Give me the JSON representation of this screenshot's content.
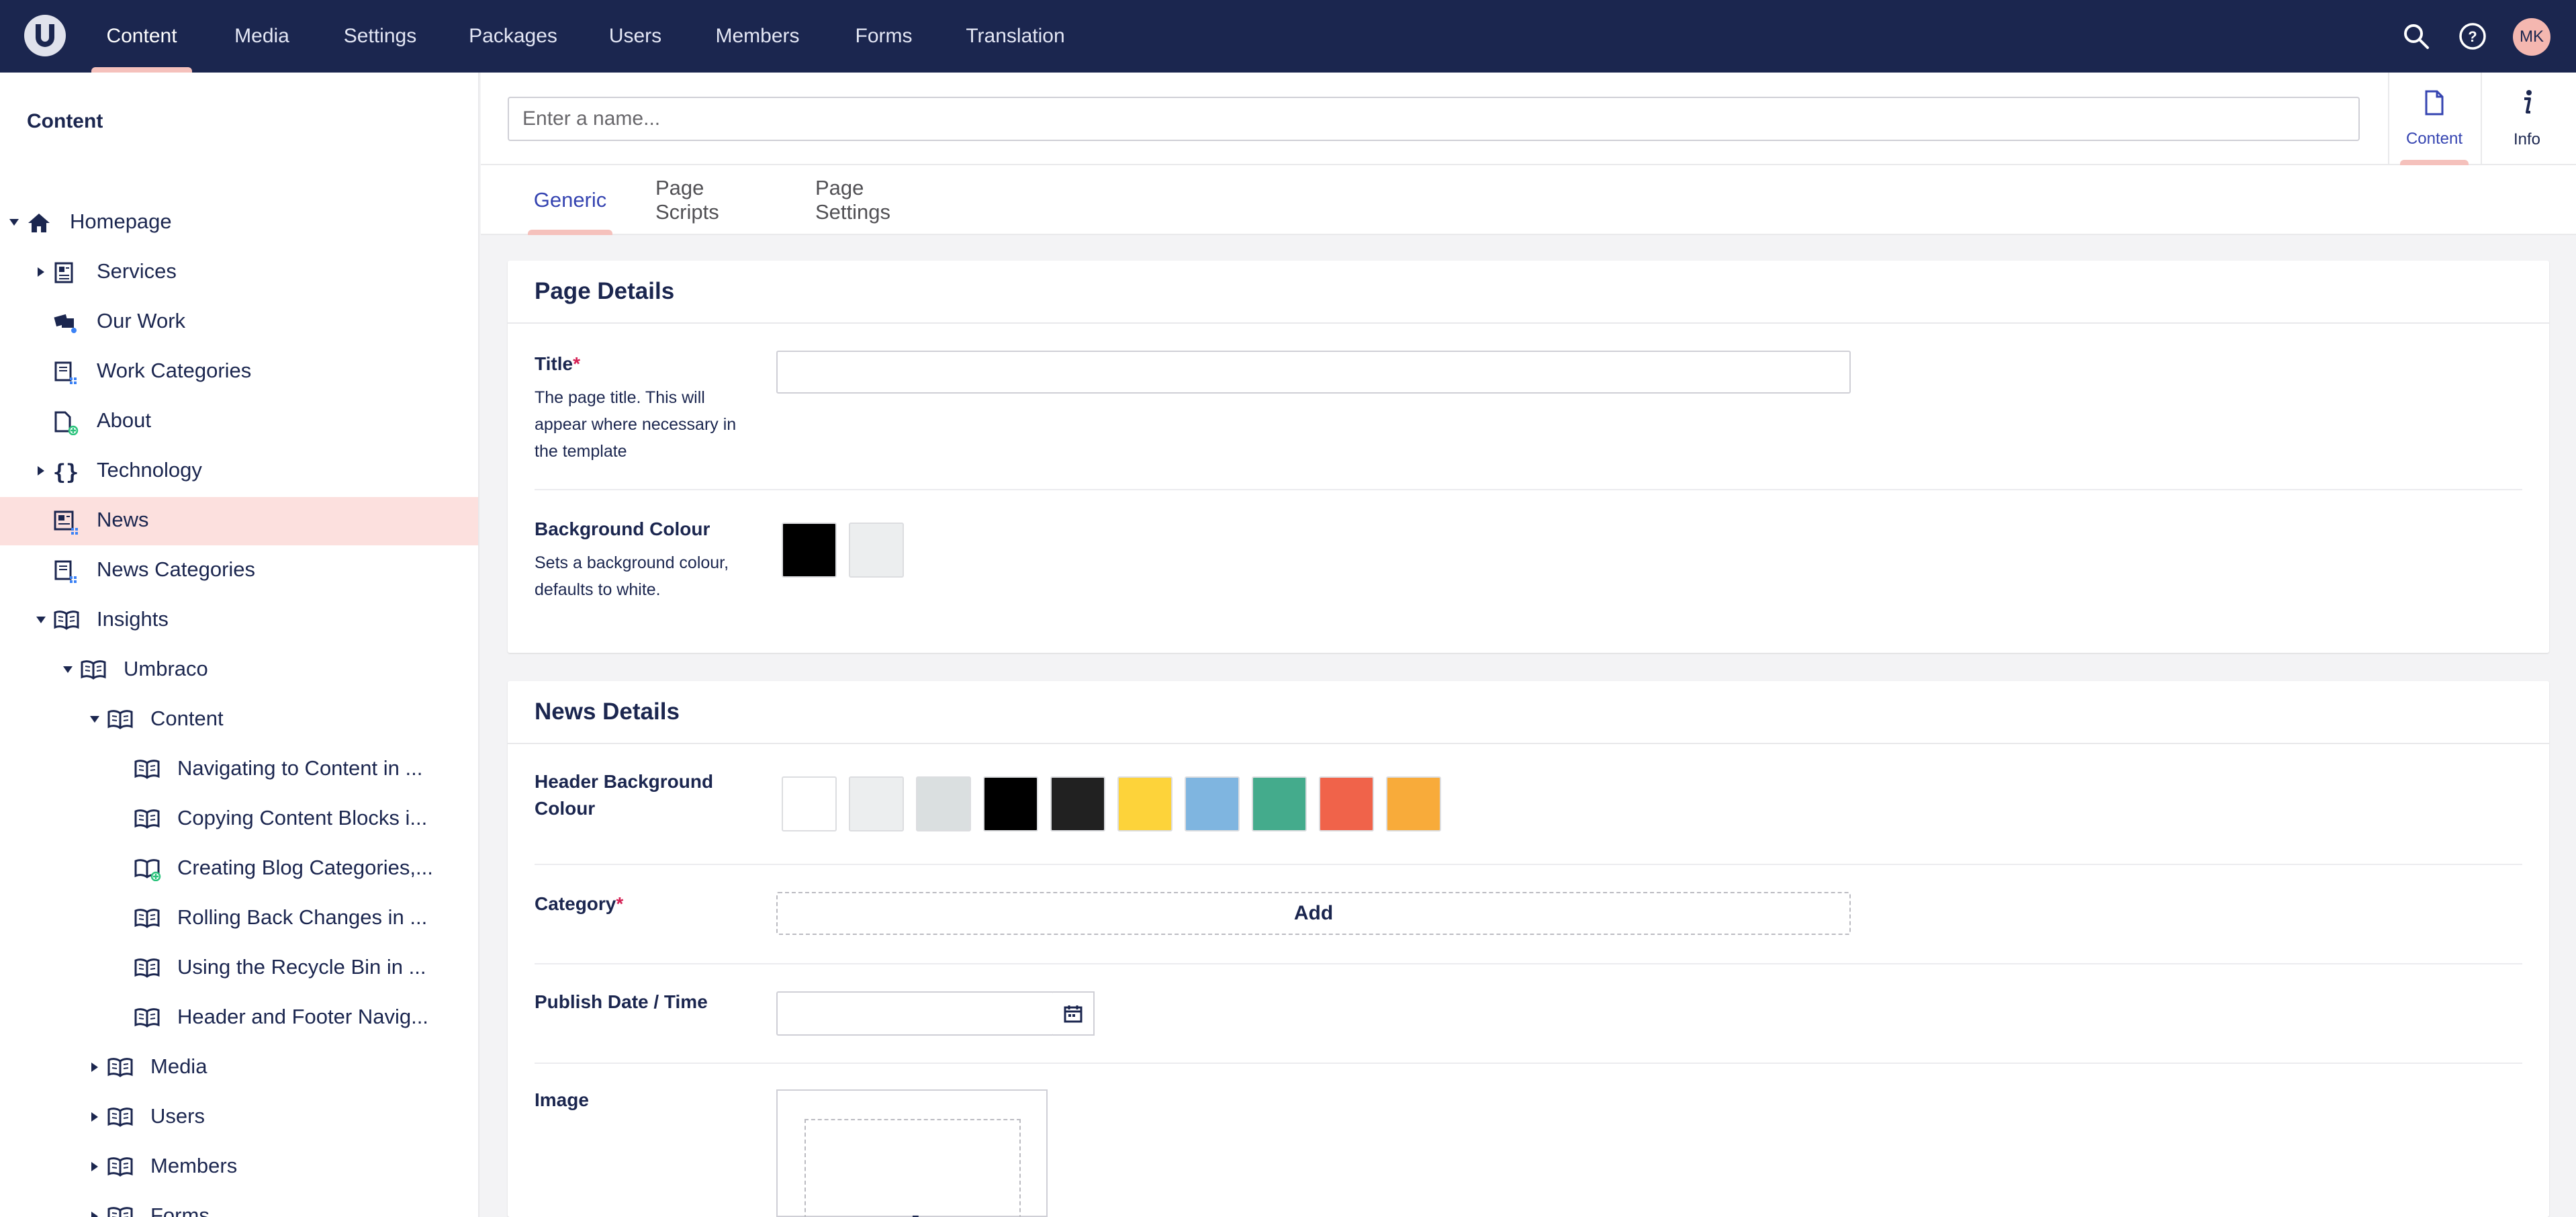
{
  "topbar": {
    "sections": [
      {
        "label": "Content",
        "active": true
      },
      {
        "label": "Media"
      },
      {
        "label": "Settings"
      },
      {
        "label": "Packages"
      },
      {
        "label": "Users"
      },
      {
        "label": "Members"
      },
      {
        "label": "Forms"
      },
      {
        "label": "Translation"
      }
    ],
    "user_initials": "MK"
  },
  "sidebar": {
    "title": "Content",
    "tree": [
      {
        "label": "Homepage",
        "expanded": true,
        "icon": "home-icon"
      },
      {
        "label": "Services",
        "collapsed": true,
        "icon": "list-doc-icon"
      },
      {
        "label": "Our Work",
        "icon": "gallery-icon"
      },
      {
        "label": "Work Categories",
        "icon": "doc-grid-icon"
      },
      {
        "label": "About",
        "icon": "doc-plus-icon"
      },
      {
        "label": "Technology",
        "collapsed": true,
        "icon": "code-braces-icon"
      },
      {
        "label": "News",
        "active": true,
        "icon": "news-icon"
      },
      {
        "label": "News Categories",
        "icon": "doc-grid-icon"
      },
      {
        "label": "Insights",
        "expanded": true,
        "icon": "book-icon"
      },
      {
        "label": "Umbraco",
        "expanded": true,
        "icon": "book-icon"
      },
      {
        "label": "Content",
        "expanded": true,
        "icon": "book-icon"
      },
      {
        "label": "Navigating to Content in ...",
        "icon": "book-icon"
      },
      {
        "label": "Copying Content Blocks i...",
        "icon": "book-icon"
      },
      {
        "label": "Creating Blog Categories,...",
        "icon": "book-plus-icon"
      },
      {
        "label": "Rolling Back Changes in ...",
        "icon": "book-icon"
      },
      {
        "label": "Using the Recycle Bin in ...",
        "icon": "book-icon"
      },
      {
        "label": "Header and Footer Navig...",
        "icon": "book-icon"
      },
      {
        "label": "Media",
        "collapsed": true,
        "icon": "book-icon"
      },
      {
        "label": "Users",
        "collapsed": true,
        "icon": "book-icon"
      },
      {
        "label": "Members",
        "collapsed": true,
        "icon": "book-icon"
      },
      {
        "label": "Forms",
        "collapsed": true,
        "icon": "book-icon"
      }
    ]
  },
  "editor": {
    "name_placeholder": "Enter a name...",
    "apps": [
      {
        "label": "Content",
        "icon": "document-icon",
        "active": true
      },
      {
        "label": "Info",
        "icon": "info-icon"
      }
    ],
    "tabs": [
      {
        "label": "Generic",
        "active": true
      },
      {
        "label": "Page Scripts"
      },
      {
        "label": "Page Settings"
      }
    ]
  },
  "page_details": {
    "title": "Page Details",
    "title_prop": {
      "label": "Title",
      "required_mark": "*",
      "description": "The page title. This will appear where necessary in the template"
    },
    "background": {
      "label": "Background Colour",
      "description": "Sets a background colour, defaults to white.",
      "swatches": [
        "#000000",
        "#eceeef"
      ]
    }
  },
  "news_details": {
    "title": "News Details",
    "header_bg": {
      "label": "Header Background Colour",
      "swatches": [
        "#ffffff",
        "#eceeef",
        "#dadfe0",
        "#000000",
        "#212121",
        "#fdd33a",
        "#7fb5e0",
        "#44ab8c",
        "#f0634a",
        "#f8ab3a"
      ]
    },
    "category": {
      "label": "Category",
      "required_mark": "*",
      "add_label": "Add"
    },
    "publish": {
      "label": "Publish Date / Time"
    },
    "image": {
      "label": "Image",
      "plus": "+"
    }
  }
}
